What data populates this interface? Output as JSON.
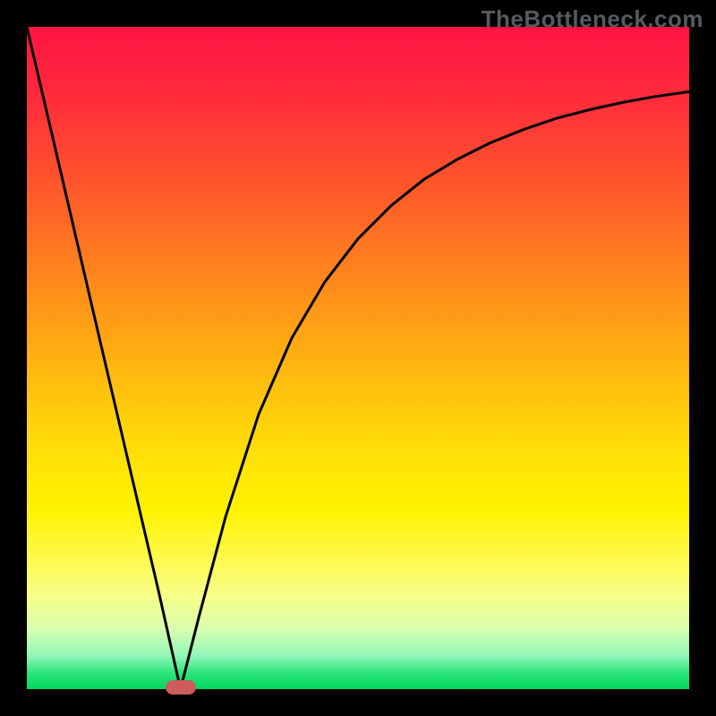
{
  "watermark": "TheBottleneck.com",
  "chart_data": {
    "type": "line",
    "title": "",
    "xlabel": "",
    "ylabel": "",
    "xlim": [
      0,
      1
    ],
    "ylim": [
      0,
      1
    ],
    "x": [
      0.0,
      0.05,
      0.1,
      0.15,
      0.2,
      0.232,
      0.26,
      0.3,
      0.35,
      0.4,
      0.45,
      0.5,
      0.55,
      0.6,
      0.65,
      0.7,
      0.75,
      0.8,
      0.85,
      0.9,
      0.95,
      1.0
    ],
    "y": [
      1.0,
      0.786,
      0.571,
      0.357,
      0.143,
      0.0,
      0.11,
      0.26,
      0.415,
      0.53,
      0.615,
      0.68,
      0.73,
      0.77,
      0.8,
      0.825,
      0.845,
      0.862,
      0.875,
      0.886,
      0.895,
      0.902
    ],
    "minimum_marker": {
      "x": 0.232,
      "y": 0.0
    },
    "annotations": []
  },
  "colors": {
    "curve": "#000000",
    "marker": "#cd5c5c",
    "frame": "#000000"
  }
}
